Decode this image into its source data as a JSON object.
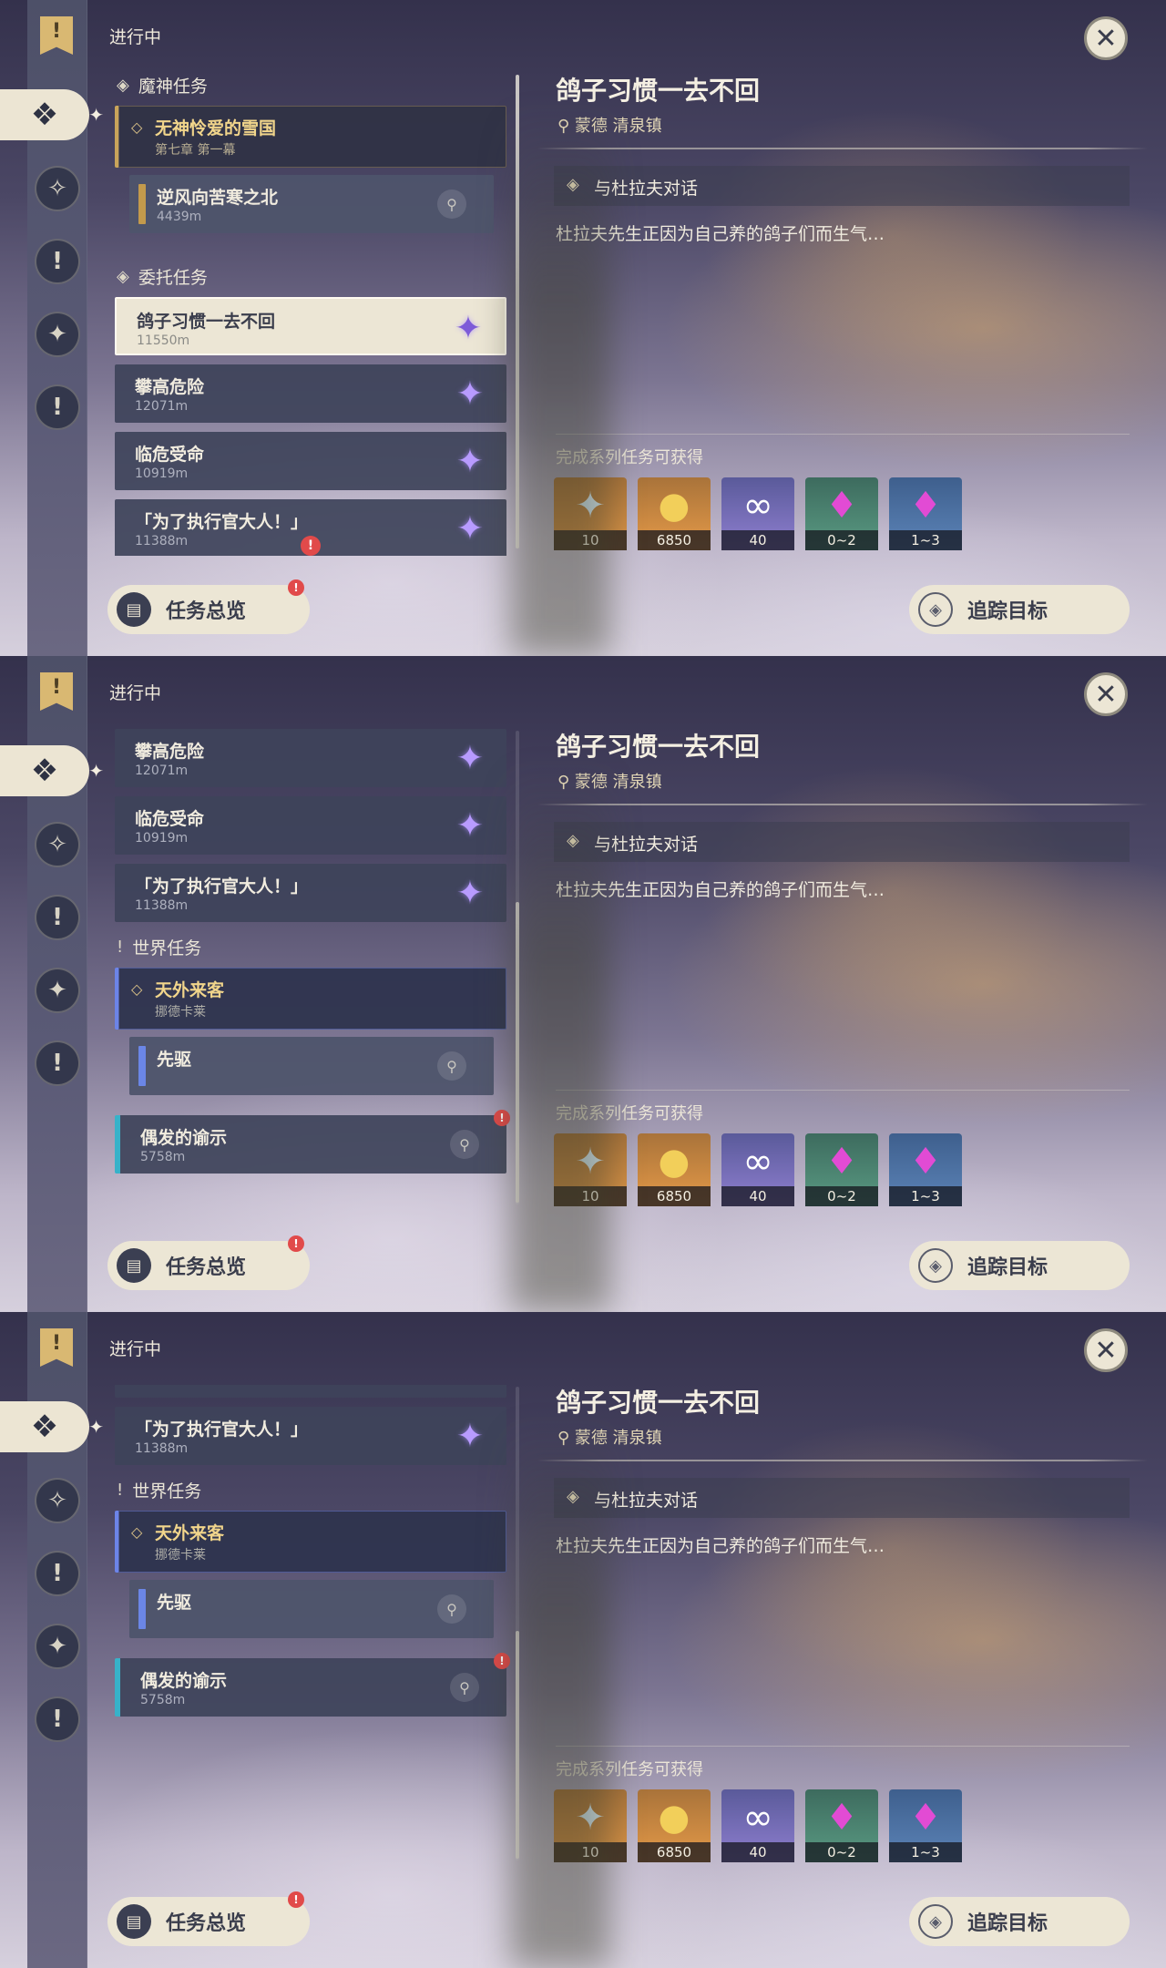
{
  "status_label": "进行中",
  "sections": {
    "archon": "魔神任务",
    "commission": "委托任务",
    "world": "世界任务"
  },
  "quests": {
    "archon_main": {
      "title": "无神怜爱的雪国",
      "sub": "第七章 第一幕"
    },
    "archon_step": {
      "title": "逆风向苦寒之北",
      "distance": "4439m"
    },
    "commission_1": {
      "title": "鸽子习惯一去不回",
      "distance": "11550m"
    },
    "commission_2": {
      "title": "攀高危险",
      "distance": "12071m"
    },
    "commission_3": {
      "title": "临危受命",
      "distance": "10919m"
    },
    "commission_4": {
      "title": "「为了执行官大人！」",
      "distance": "11388m"
    },
    "world_main": {
      "title": "天外来客",
      "sub": "挪德卡莱"
    },
    "world_step": {
      "title": "先驱"
    },
    "world_2": {
      "title": "偶发的谕示",
      "distance": "5758m"
    }
  },
  "detail": {
    "title": "鸽子习惯一去不回",
    "location": "蒙德 清泉镇",
    "objective": "与杜拉夫对话",
    "description": "杜拉夫先生正因为自己养的鸽子们而生气…",
    "rewards_title": "完成系列任务可获得",
    "rewards": [
      {
        "icon": "primogem-icon",
        "qty": "10"
      },
      {
        "icon": "mora-icon",
        "qty": "6850"
      },
      {
        "icon": "friendship-icon",
        "qty": "40"
      },
      {
        "icon": "crystal-chunk-icon",
        "qty": "0~2"
      },
      {
        "icon": "crystal-cluster-icon",
        "qty": "1~3"
      }
    ]
  },
  "buttons": {
    "overview": "任务总览",
    "track": "追踪目标"
  },
  "badge_text": "!",
  "colors": {
    "gold": "#c9a45a",
    "world_blue": "#6c84e8",
    "alert_red": "#e14a4a",
    "panel_cream": "#ece6d5"
  }
}
